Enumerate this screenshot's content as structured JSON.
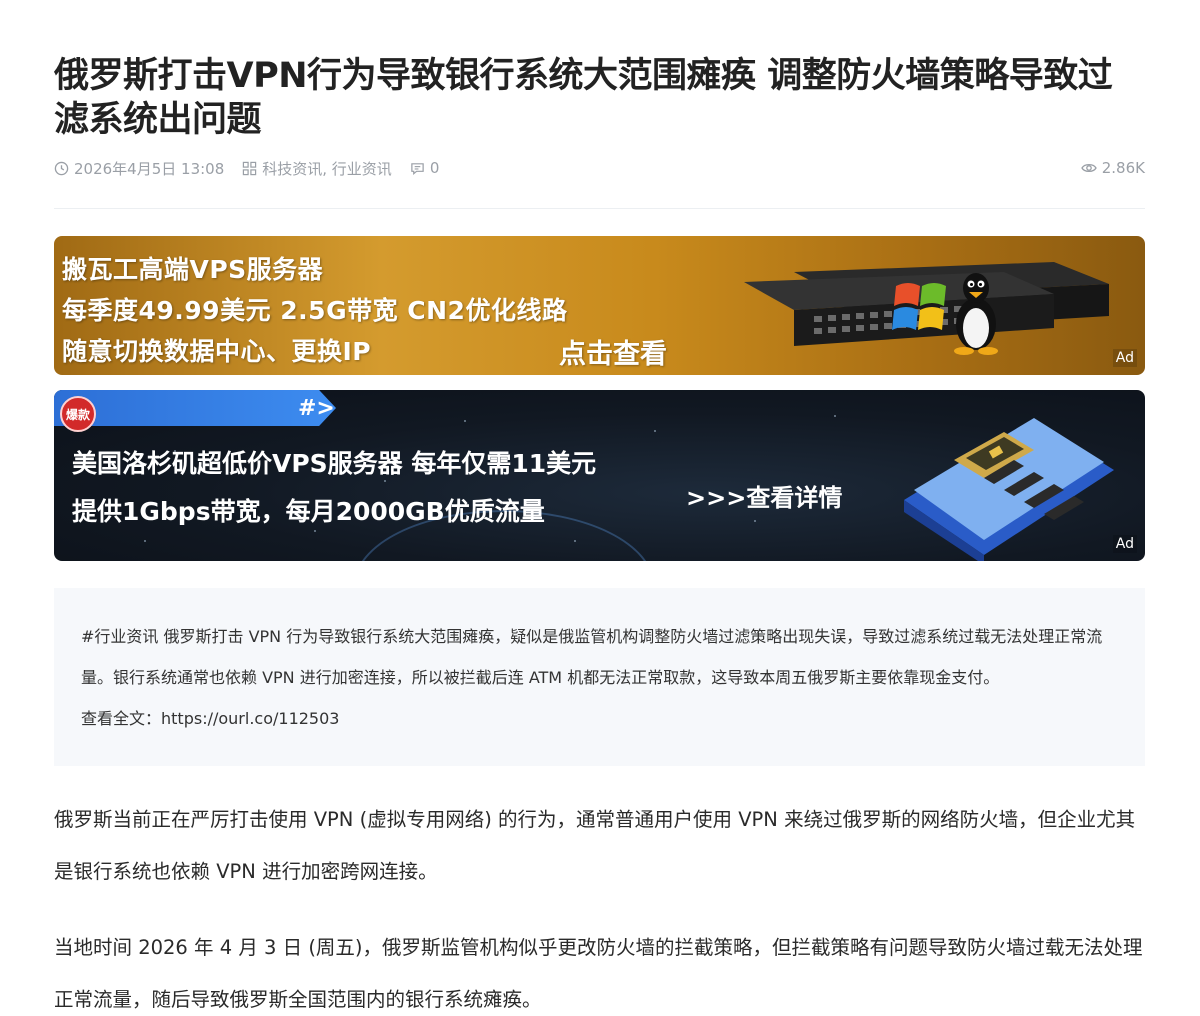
{
  "article": {
    "title": "俄罗斯打击VPN行为导致银行系统大范围瘫痪 调整防火墙策略导致过滤系统出问题",
    "date": "2026年4月5日 13:08",
    "categories": "科技资讯, 行业资讯",
    "comments": "0",
    "views": "2.86K"
  },
  "ads": {
    "ad1": {
      "line1": "搬瓦工高端VPS服务器",
      "line2": "每季度49.99美元 2.5G带宽 CN2优化线路",
      "line3": "随意切换数据中心、更换IP",
      "cta": "点击查看",
      "tag": "Ad"
    },
    "ad2": {
      "badge": "爆款",
      "hash": "#>",
      "line1": "美国洛杉矶超低价VPS服务器 每年仅需11美元",
      "line2": "提供1Gbps带宽，每月2000GB优质流量",
      "cta": ">>>查看详情",
      "tag": "Ad"
    }
  },
  "summary": {
    "text": "#行业资讯 俄罗斯打击 VPN 行为导致银行系统大范围瘫痪，疑似是俄监管机构调整防火墙过滤策略出现失误，导致过滤系统过载无法处理正常流量。银行系统通常也依赖 VPN 进行加密连接，所以被拦截后连 ATM 机都无法正常取款，这导致本周五俄罗斯主要依靠现金支付。",
    "link_label": "查看全文：",
    "link_url": "https://ourl.co/112503"
  },
  "paragraphs": [
    "俄罗斯当前正在严厉打击使用 VPN (虚拟专用网络) 的行为，通常普通用户使用 VPN 来绕过俄罗斯的网络防火墙，但企业尤其是银行系统也依赖 VPN 进行加密跨网连接。",
    "当地时间 2026 年 4 月 3 日 (周五)，俄罗斯监管机构似乎更改防火墙的拦截策略，但拦截策略有问题导致防火墙过载无法处理正常流量，随后导致俄罗斯全国范围内的银行系统瘫痪。"
  ]
}
